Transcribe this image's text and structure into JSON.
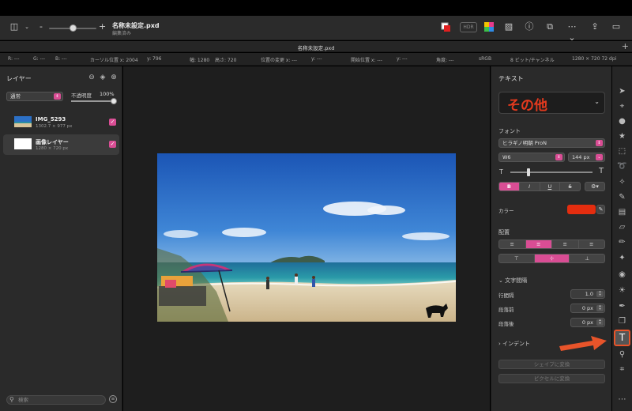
{
  "document": {
    "title": "名称未設定.pxd",
    "subtitle": "編集済み",
    "tab_title": "名称未設定.pxd"
  },
  "toolbar": {
    "hdr_label": "HDR",
    "zoom_minus": "-",
    "zoom_plus": "+"
  },
  "info_bar": [
    "R: ---",
    "G: ---",
    "B: ---",
    "カーソル位置 x: 2004",
    "y: 796",
    "幅: 1280",
    "高さ: 720",
    "位置の変更 x: ---",
    "y: ---",
    "開始位置 x: ---",
    "y: ---",
    "角度: ---",
    "sRGB",
    "8 ビット/チャンネル",
    "1280 × 720 72 dpi"
  ],
  "layers_panel": {
    "title": "レイヤー",
    "blend_mode": "通常",
    "opacity_label": "不透明度",
    "opacity_value": "100%",
    "opacity_fraction": 1.0,
    "layers": [
      {
        "name": "IMG_5293",
        "size": "1302.7 × 977 px",
        "visible": true
      },
      {
        "name": "画像レイヤー",
        "size": "1280 × 720 px",
        "visible": true
      }
    ],
    "search_placeholder": "検索"
  },
  "text_panel": {
    "title": "テキスト",
    "preset_text": "その他",
    "font_label": "フォント",
    "font_family": "ヒラギノ明朝 ProN",
    "font_weight": "W6",
    "font_size": "144 px",
    "size_slider_fraction": 0.2,
    "style_buttons": [
      "B",
      "I",
      "U",
      "S"
    ],
    "active_style": "B",
    "gear_label": "⚙▾",
    "color_label": "カラー",
    "color_value": "#e42d0f",
    "align_label": "配置",
    "horizontal_align": [
      "≡",
      "≡",
      "≡",
      "≡"
    ],
    "vertical_align": [
      "⊤",
      "⊹",
      "⊥"
    ],
    "spacing_section": "文字間隔",
    "line_spacing_label": "行間隔",
    "line_spacing_value": "1.0",
    "space_before_label": "段落前",
    "space_before_value": "0 px",
    "space_after_label": "段落後",
    "space_after_value": "0 px",
    "indent_section": "インデント",
    "convert_shape": "シェイプに変換",
    "convert_pixels": "ピクセルに変換"
  },
  "colors": {
    "accent": "#d94d94",
    "highlight": "#e8542a",
    "text_color": "#e42d0f"
  },
  "tools": [
    "arrow-tool-icon",
    "pen-select-icon",
    "shapes-icon",
    "star-icon",
    "selection-icon",
    "lasso-icon",
    "magic-wand-icon",
    "brush-icon",
    "gradient-icon",
    "eraser-icon",
    "pencil-icon",
    "retouch-icon",
    "blur-icon",
    "light-icon",
    "pen-tool-icon",
    "clone-icon",
    "text-tool-icon",
    "zoom-icon",
    "crop-icon",
    "more-icon"
  ]
}
